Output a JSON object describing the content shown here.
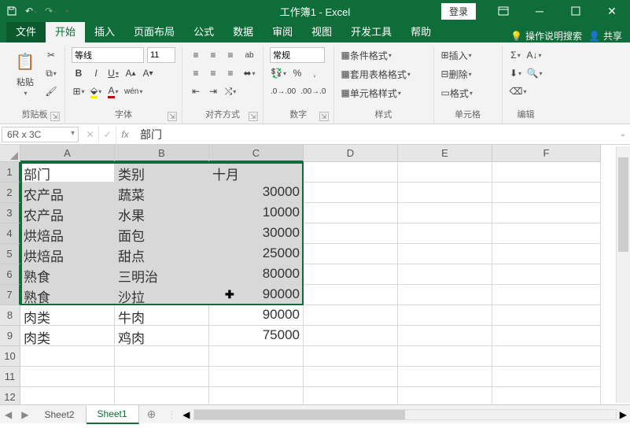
{
  "titlebar": {
    "title": "工作簿1 - Excel",
    "login": "登录"
  },
  "tabs": {
    "file": "文件",
    "items": [
      "开始",
      "插入",
      "页面布局",
      "公式",
      "数据",
      "审阅",
      "视图",
      "开发工具",
      "帮助"
    ],
    "tell": "操作说明搜索",
    "share": "共享"
  },
  "ribbon": {
    "g_clipboard": "剪贴板",
    "paste": "粘贴",
    "g_font": "字体",
    "font_name": "等线",
    "font_size": "11",
    "g_align": "对齐方式",
    "g_number": "数字",
    "num_format": "常规",
    "g_styles": "样式",
    "cond_fmt": "条件格式",
    "table_fmt": "套用表格格式",
    "cell_style": "单元格样式",
    "g_cells": "单元格",
    "insert": "插入",
    "delete": "删除",
    "format": "格式",
    "g_editing": "编辑"
  },
  "namebox": "6R x 3C",
  "formula": "部门",
  "columns": [
    "A",
    "B",
    "C",
    "D",
    "E",
    "F"
  ],
  "rows": [
    {
      "n": "1",
      "A": "部门",
      "B": "类别",
      "C": "十月",
      "sel": true,
      "hdr": true
    },
    {
      "n": "2",
      "A": "农产品",
      "B": "蔬菜",
      "C": "30000",
      "sel": true
    },
    {
      "n": "3",
      "A": "农产品",
      "B": "水果",
      "C": "10000",
      "sel": true
    },
    {
      "n": "4",
      "A": "烘焙品",
      "B": "面包",
      "C": "30000",
      "sel": true
    },
    {
      "n": "5",
      "A": "烘焙品",
      "B": "甜点",
      "C": "25000",
      "sel": true
    },
    {
      "n": "6",
      "A": "熟食",
      "B": "三明治",
      "C": "80000",
      "sel": true
    },
    {
      "n": "7",
      "A": "熟食",
      "B": "沙拉",
      "C": "90000",
      "sel": true
    },
    {
      "n": "8",
      "A": "肉类",
      "B": "牛肉",
      "C": "90000"
    },
    {
      "n": "9",
      "A": "肉类",
      "B": "鸡肉",
      "C": "75000"
    },
    {
      "n": "10"
    },
    {
      "n": "11"
    },
    {
      "n": "12"
    }
  ],
  "sheets": {
    "tabs": [
      "Sheet2",
      "Sheet1"
    ],
    "active": "Sheet1"
  }
}
